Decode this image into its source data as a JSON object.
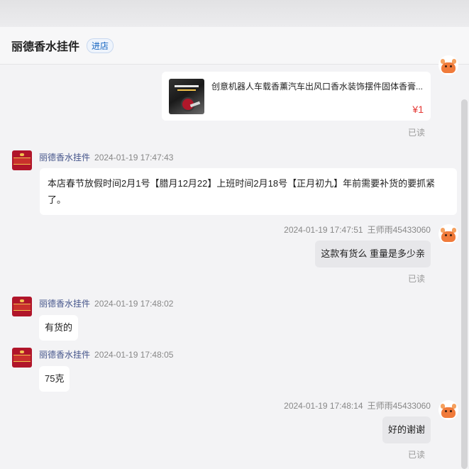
{
  "header": {
    "shop_title": "丽德香水挂件",
    "enter_store": "进店"
  },
  "product": {
    "title": "创意机器人车载香薰汽车出风口香水装饰摆件固体香膏...",
    "price": "¥1"
  },
  "read_label": "已读",
  "messages": [
    {
      "sender": "丽德香水挂件",
      "time": "2024-01-19 17:47:43",
      "text": "本店春节放假时间2月1号【腊月12月22】上班时间2月18号【正月初九】年前需要补货的要抓紧了。",
      "direction": "in"
    },
    {
      "sender": "王师雨45433060",
      "time": "2024-01-19 17:47:51",
      "text": "这款有货么  重量是多少亲",
      "direction": "out"
    },
    {
      "sender": "丽德香水挂件",
      "time": "2024-01-19 17:48:02",
      "text": "有货的",
      "direction": "in"
    },
    {
      "sender": "丽德香水挂件",
      "time": "2024-01-19 17:48:05",
      "text": "75克",
      "direction": "in"
    },
    {
      "sender": "王师雨45433060",
      "time": "2024-01-19 17:48:14",
      "text": "好的谢谢",
      "direction": "out"
    }
  ],
  "colors": {
    "background": "#f3f3f5",
    "price": "#e53935",
    "sender_name": "#44548a",
    "enter_store": "#1565c0"
  }
}
